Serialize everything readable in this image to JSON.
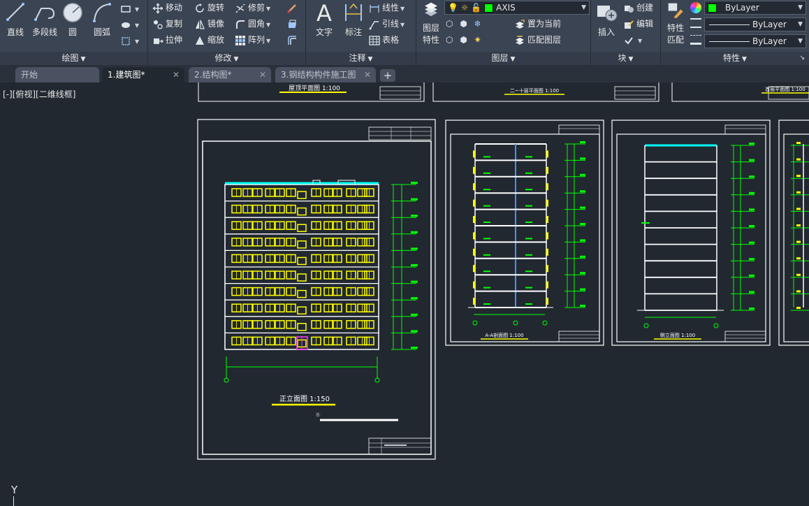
{
  "ribbon": {
    "draw_panel": {
      "title": "绘图",
      "tools": {
        "line": "直线",
        "polyline": "多段线",
        "circle": "圆",
        "arc": "圆弧"
      }
    },
    "modify_panel": {
      "title": "修改",
      "tools": {
        "move": "移动",
        "rotate": "旋转",
        "trim": "修剪",
        "copy": "复制",
        "mirror": "镜像",
        "fillet": "圆角",
        "stretch": "拉伸",
        "scale": "缩放",
        "array": "阵列"
      }
    },
    "annotation_panel": {
      "title": "注释",
      "tools": {
        "text": "文字",
        "dimension": "标注",
        "linear": "线性",
        "leader": "引线",
        "table": "表格"
      }
    },
    "layers_panel": {
      "title": "图层",
      "layer_properties": "图层\n特性",
      "layer_properties_l1": "图层",
      "layer_properties_l2": "特性",
      "current_layer": "AXIS",
      "current_layer_color": "#00ff00",
      "set_current": "置为当前",
      "match_layer": "匹配图层"
    },
    "block_panel": {
      "title": "块",
      "insert": "插入",
      "create": "创建",
      "edit": "编辑"
    },
    "properties_panel": {
      "title": "特性",
      "match_properties_l1": "特性",
      "match_properties_l2": "匹配",
      "color": "ByLayer",
      "color_swatch": "#00ff00",
      "linetype": "ByLayer",
      "lineweight": "ByLayer"
    }
  },
  "tabs": [
    {
      "label": "开始"
    },
    {
      "label": "1.建筑图*"
    },
    {
      "label": "2.结构图*"
    },
    {
      "label": "3.钢结构构件施工图"
    }
  ],
  "viewport": {
    "view_control": "[-][俯视][二维线框]",
    "ucs_y": "Y"
  },
  "drawings": {
    "top_sheet_1": "屋顶平面图 1:100",
    "top_sheet_2": "二~十层平面图 1:100",
    "top_sheet_3": "首层平面图 1:100",
    "front_elevation": "正立面图 1:150",
    "section": "A-A剖面图 1:100",
    "side_elevation": "侧立面图 1:100"
  },
  "colors": {
    "accent_green": "#00ff00",
    "accent_yellow": "#ffff00",
    "cyan": "#00ffff",
    "background": "#212830"
  }
}
